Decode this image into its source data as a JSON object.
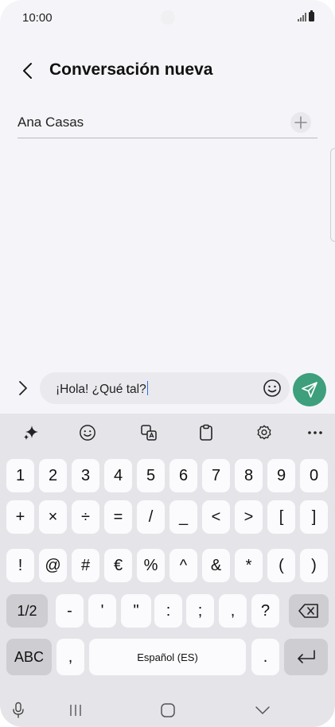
{
  "status_bar": {
    "time": "10:00"
  },
  "header": {
    "title": "Conversación nueva"
  },
  "recipient": {
    "name": "Ana Casas"
  },
  "compose": {
    "message": "¡Hola! ¿Qué tal?"
  },
  "colors": {
    "send_button": "#3d9f7b",
    "cursor": "#2e6ff2",
    "background": "#f5f5f9",
    "keyboard": "#e5e5e9"
  },
  "keyboard_toolbar": [
    "sparkle-icon",
    "emoji-icon",
    "translate-icon",
    "clipboard-icon",
    "settings-icon",
    "more-icon"
  ],
  "keyboard": {
    "row1": [
      "1",
      "2",
      "3",
      "4",
      "5",
      "6",
      "7",
      "8",
      "9",
      "0"
    ],
    "row2": [
      "+",
      "×",
      "÷",
      "=",
      "/",
      "_",
      "<",
      ">",
      "[",
      "]"
    ],
    "row3": [
      "!",
      "@",
      "#",
      "€",
      "%",
      "^",
      "&",
      "*",
      "(",
      ")"
    ],
    "row4_shift": "1/2",
    "row4": [
      "-",
      "'",
      "\"",
      ":",
      ";",
      ",",
      "?"
    ],
    "abc": "ABC",
    "comma": ",",
    "space": "Español (ES)",
    "period": "."
  }
}
